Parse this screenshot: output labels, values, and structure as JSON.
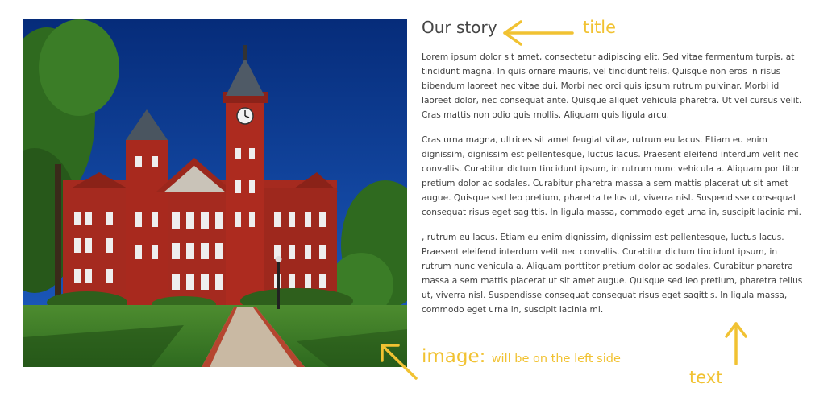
{
  "story": {
    "title": "Our story",
    "paragraphs": [
      "Lorem ipsum dolor sit amet, consectetur adipiscing elit. Sed vitae fermentum turpis, at tincidunt magna. In quis ornare mauris, vel tincidunt felis. Quisque non eros in risus bibendum laoreet nec vitae dui. Morbi nec orci quis ipsum rutrum pulvinar. Morbi id laoreet dolor, nec consequat ante. Quisque aliquet vehicula pharetra. Ut vel cursus velit. Cras mattis non odio quis mollis. Aliquam quis ligula arcu.",
      "Cras urna magna, ultrices sit amet feugiat vitae, rutrum eu lacus. Etiam eu enim dignissim, dignissim est pellentesque, luctus lacus. Praesent eleifend interdum velit nec convallis. Curabitur dictum tincidunt ipsum, in rutrum nunc vehicula a. Aliquam porttitor pretium dolor ac sodales. Curabitur pharetra massa a sem mattis placerat ut sit amet augue. Quisque sed leo pretium, pharetra tellus ut, viverra nisl. Suspendisse consequat consequat risus eget sagittis. In ligula massa, commodo eget urna in, suscipit lacinia mi.",
      ", rutrum eu lacus. Etiam eu enim dignissim, dignissim est pellentesque, luctus lacus. Praesent eleifend interdum velit nec convallis. Curabitur dictum tincidunt ipsum, in rutrum nunc vehicula a. Aliquam porttitor pretium dolor ac sodales. Curabitur pharetra massa a sem mattis placerat ut sit amet augue. Quisque sed leo pretium, pharetra tellus ut, viverra nisl. Suspendisse consequat consequat risus eget sagittis. In ligula massa, commodo eget urna in, suscipit lacinia mi."
    ]
  },
  "annotations": {
    "title_label": "title",
    "image_label": "image:",
    "image_note": "will be on the left side",
    "text_label": "text",
    "color": "#f1c232"
  },
  "photo": {
    "subject": "red brick clock tower building with lawn and walkway",
    "sky_color": "#0b3f9c",
    "brick_color": "#a52a1f",
    "lawn_color": "#3f7d2a"
  }
}
